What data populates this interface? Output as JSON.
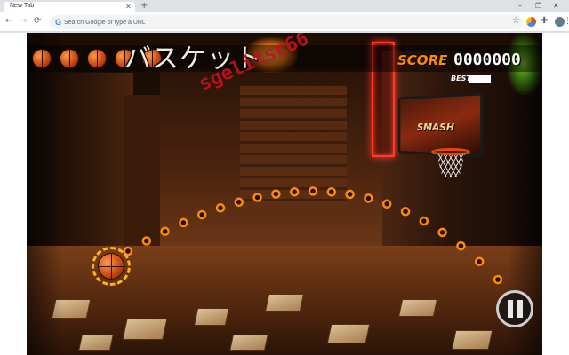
{
  "browser": {
    "tab": {
      "title": "New Tab",
      "close_icon": "close-icon"
    },
    "new_tab_icon": "plus-icon",
    "window_controls": {
      "minimize": "–",
      "restore": "❐",
      "close": "✕"
    },
    "nav": {
      "back": "←",
      "forward": "→",
      "reload": "⟳"
    },
    "omnibox": {
      "placeholder": "Search Google or type a URL",
      "value": ""
    },
    "star_glyph": "☆",
    "menu_glyph": "⋮",
    "puzzle_glyph": "✚"
  },
  "game": {
    "title": "バスケット",
    "watermark": "sgelitsc66",
    "lives_remaining": 5,
    "score_label": "SCORE",
    "score_value": "0000000",
    "best_label": "BEST",
    "backboard_label": "SMASH",
    "pause_icon": "pause-icon",
    "colors": {
      "score": "#ff8a00",
      "neon": "#ff3b2a",
      "watermark": "#c1121f",
      "trajectory": "#ff8c00"
    }
  }
}
